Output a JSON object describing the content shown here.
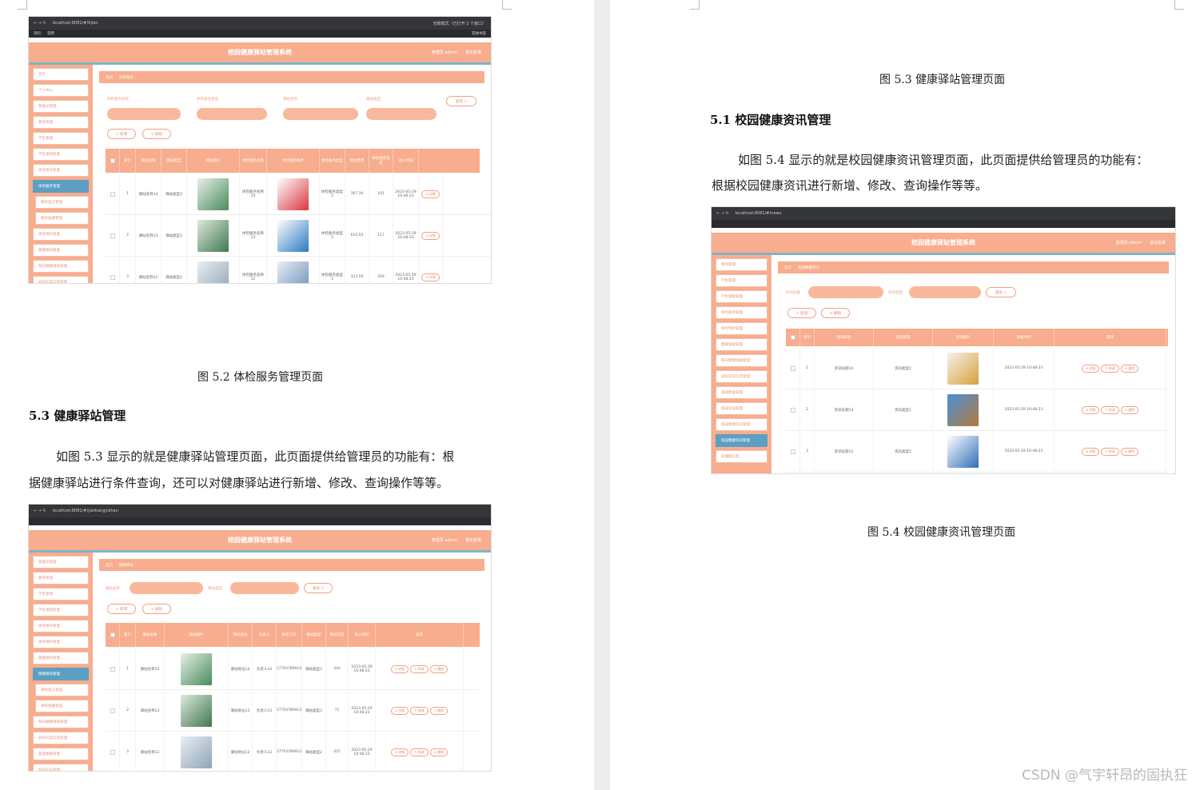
{
  "left_page": {
    "fig52": {
      "url": "localhost:8081/#/tijian",
      "bookmarks": [
        "资料",
        "常用"
      ],
      "bookmark_right": "其他书签",
      "incognito": "无痕模式（已打开 2 个窗口）",
      "app_title": "校园健康驿站管理系统",
      "admin_label": "管理员 admin",
      "logout": "退出登录",
      "breadcrumb": [
        "首页",
        "体检服务"
      ],
      "sidebar": [
        {
          "label": "首页",
          "type": "normal"
        },
        {
          "label": "个人中心",
          "type": "normal"
        },
        {
          "label": "管理员管理",
          "type": "normal"
        },
        {
          "label": "教师管理",
          "type": "normal"
        },
        {
          "label": "学生管理",
          "type": "normal"
        },
        {
          "label": "学生请假管理",
          "type": "normal"
        },
        {
          "label": "体检服务管理",
          "type": "normal"
        },
        {
          "label": "体检服务管理",
          "type": "active"
        },
        {
          "label": "服务留言管理",
          "type": "sub"
        },
        {
          "label": "服务收藏管理",
          "type": "sub"
        },
        {
          "label": "体检预约管理",
          "type": "normal"
        },
        {
          "label": "健康驿站管理",
          "type": "normal"
        },
        {
          "label": "每日健康填报管理",
          "type": "normal"
        },
        {
          "label": "返校异常信息管理",
          "type": "normal"
        }
      ],
      "filters": [
        "体检服务名称",
        "体检服务类型",
        "驿站名称",
        "驿站类型"
      ],
      "query_button": "查询 ○",
      "add_button": "+ 新增",
      "delete_button": "⊝ 删除",
      "columns": [
        "索引",
        "驿站名称",
        "驿站类型",
        "驿站图片",
        "体检服务名称",
        "体检服务照片",
        "体检服务类型",
        "体检费用",
        "体检服务热度",
        "录入时间"
      ],
      "rows": [
        {
          "idx": "1",
          "station": "驿站名称14",
          "stype": "驿站类型3",
          "service": "体检服务名称14",
          "stype2": "体检服务类型2",
          "fee": "367.34",
          "heat": "101",
          "time": "2023-05-29 10:48:23",
          "action": "⊡ 详情"
        },
        {
          "idx": "2",
          "station": "驿站名称13",
          "stype": "驿站类型3",
          "service": "体检服务名称13",
          "stype2": "体检服务类型3",
          "fee": "615.03",
          "heat": "117",
          "time": "2023-05-29 10:48:23",
          "action": "⊡ 详情"
        },
        {
          "idx": "3",
          "station": "驿站名称12",
          "stype": "驿站类型2",
          "service": "体检服务名称12",
          "stype2": "体检服务类型1",
          "fee": "323.59",
          "heat": "293",
          "time": "2023-05-29 10:48:23",
          "action": "⊡ 详情"
        }
      ]
    },
    "caption52": "图 5.2  体检服务管理页面",
    "heading53": "5.3 健康驿站管理",
    "para53_line1": "如图 5.3 显示的就是健康驿站管理页面，此页面提供给管理员的功能有：根",
    "para53_line2": "据健康驿站进行条件查询，还可以对健康驿站进行新增、修改、查询操作等等。",
    "fig53": {
      "url": "localhost:8081/#/jiankangyizhan",
      "app_title": "校园健康驿站管理系统",
      "admin_label": "管理员 admin",
      "logout": "退出登录",
      "breadcrumb": [
        "首页",
        "健康驿站"
      ],
      "sidebar": [
        {
          "label": "管理员管理",
          "type": "normal"
        },
        {
          "label": "教师管理",
          "type": "normal"
        },
        {
          "label": "学生管理",
          "type": "normal"
        },
        {
          "label": "学生请假管理",
          "type": "normal"
        },
        {
          "label": "体检服务管理",
          "type": "normal"
        },
        {
          "label": "体检预约管理",
          "type": "normal"
        },
        {
          "label": "健康驿站管理",
          "type": "normal"
        },
        {
          "label": "健康驿站管理",
          "type": "active"
        },
        {
          "label": "驿站留言管理",
          "type": "sub"
        },
        {
          "label": "驿站收藏管理",
          "type": "sub"
        },
        {
          "label": "每日健康填报管理",
          "type": "normal"
        },
        {
          "label": "返校异常信息管理",
          "type": "normal"
        },
        {
          "label": "基础数据管理",
          "type": "normal"
        },
        {
          "label": "校园论坛管理",
          "type": "normal"
        }
      ],
      "filters": [
        "驿站名称",
        "驿站类型"
      ],
      "query_button": "查询 ○",
      "add_button": "+ 新增",
      "delete_button": "⊝ 删除",
      "columns": [
        "索引",
        "驿站名称",
        "驿站图片",
        "驿站地址",
        "负责人",
        "联系方式",
        "驿站类型",
        "驿站热度",
        "录入时间",
        "操作"
      ],
      "rows": [
        {
          "idx": "1",
          "name": "驿站名称14",
          "addr": "驿站地址14",
          "person": "负责人14",
          "phone": "17703786914",
          "type": "驿站类型3",
          "heat": "343",
          "time": "2023-05-29 10:48:23"
        },
        {
          "idx": "2",
          "name": "驿站名称13",
          "addr": "驿站地址13",
          "person": "负责人13",
          "phone": "17703786913",
          "type": "驿站类型3",
          "heat": "71",
          "time": "2023-05-29 10:48:23"
        },
        {
          "idx": "3",
          "name": "驿站名称12",
          "addr": "驿站地址12",
          "person": "负责人12",
          "phone": "17703786912",
          "type": "驿站类型2",
          "heat": "415",
          "time": "2023-05-29 10:48:23"
        }
      ],
      "actions": [
        "⊡ 详情",
        "✎ 修改",
        "⊝ 删除"
      ]
    }
  },
  "right_page": {
    "caption53": "图 5.3  健康驿站管理页面",
    "heading51": "5.1 校园健康资讯管理",
    "para51_line1": "如图 5.4 显示的就是校园健康资讯管理页面，此页面提供给管理员的功能有：",
    "para51_line2": "根据校园健康资讯进行新增、修改、查询操作等等。",
    "fig54": {
      "url": "localhost:8081/#/news",
      "app_title": "校园健康驿站管理系统",
      "admin_label": "管理员 admin",
      "logout": "退出登录",
      "breadcrumb": [
        "首页",
        "校园健康资讯"
      ],
      "sidebar": [
        {
          "label": "教师管理",
          "type": "normal"
        },
        {
          "label": "学生管理",
          "type": "normal"
        },
        {
          "label": "学生请假管理",
          "type": "normal"
        },
        {
          "label": "体检服务管理",
          "type": "normal"
        },
        {
          "label": "体检预约管理",
          "type": "normal"
        },
        {
          "label": "健康驿站管理",
          "type": "normal"
        },
        {
          "label": "每日健康填报管理",
          "type": "normal"
        },
        {
          "label": "返校异常信息管理",
          "type": "normal"
        },
        {
          "label": "基础数据管理",
          "type": "normal"
        },
        {
          "label": "校园论坛管理",
          "type": "normal"
        },
        {
          "label": "校园健康资讯管理",
          "type": "normal"
        },
        {
          "label": "校园健康资讯管理",
          "type": "active"
        },
        {
          "label": "轮播图信息",
          "type": "normal"
        }
      ],
      "filters": [
        "资讯标题",
        "资讯类型"
      ],
      "query_button": "查询 ○",
      "add_button": "+ 新增",
      "delete_button": "⊝ 删除",
      "columns": [
        "索引",
        "资讯标题",
        "资讯类型",
        "资讯图片",
        "添加时间",
        "操作"
      ],
      "rows": [
        {
          "idx": "1",
          "title": "资讯标题14",
          "type": "资讯类型2",
          "time": "2023-05-29 10:48:23"
        },
        {
          "idx": "2",
          "title": "资讯标题13",
          "type": "资讯类型1",
          "time": "2023-05-29 10:48:23"
        },
        {
          "idx": "3",
          "title": "资讯标题12",
          "type": "资讯类型2",
          "time": "2023-05-29 10:48:23"
        }
      ],
      "actions": [
        "⊡ 详情",
        "✎ 修改",
        "⊝ 删除"
      ]
    },
    "caption54": "图 5.4  校园健康资讯管理页面"
  },
  "watermark": "CSDN @气宇轩昂的固执狂",
  "colors": {
    "accent": "#f8ad8e",
    "active": "#5b9fc2",
    "chrome": "#35363a"
  }
}
